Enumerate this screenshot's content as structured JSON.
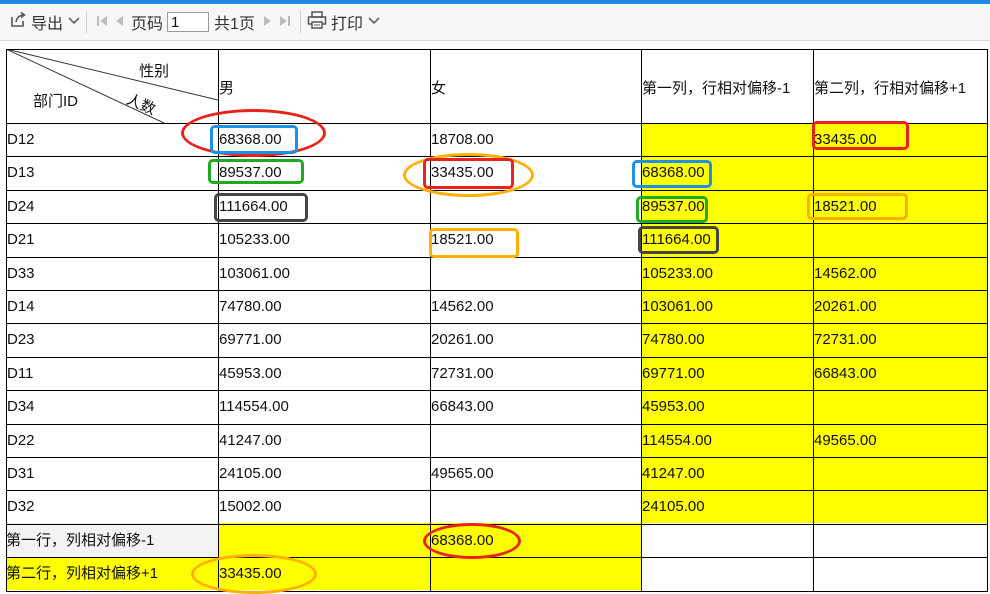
{
  "toolbar": {
    "export_label": "导出",
    "page_label": "页码",
    "page_value": "1",
    "total_label": "共1页",
    "print_label": "打印"
  },
  "table": {
    "corner": {
      "dept": "部门ID",
      "gender": "性别",
      "count": "人数"
    },
    "headers": [
      "男",
      "女",
      "第一列，行相对偏移-1",
      "第二列，行相对偏移+1"
    ],
    "rows": [
      {
        "id": "D12",
        "male": "68368.00",
        "female": "18708.00",
        "col1": "",
        "col2": "33435.00"
      },
      {
        "id": "D13",
        "male": "89537.00",
        "female": "33435.00",
        "col1": "68368.00",
        "col2": ""
      },
      {
        "id": "D24",
        "male": "111664.00",
        "female": "",
        "col1": "89537.00",
        "col2": "18521.00"
      },
      {
        "id": "D21",
        "male": "105233.00",
        "female": "18521.00",
        "col1": "111664.00",
        "col2": ""
      },
      {
        "id": "D33",
        "male": "103061.00",
        "female": "",
        "col1": "105233.00",
        "col2": "14562.00"
      },
      {
        "id": "D14",
        "male": "74780.00",
        "female": "14562.00",
        "col1": "103061.00",
        "col2": "20261.00"
      },
      {
        "id": "D23",
        "male": "69771.00",
        "female": "20261.00",
        "col1": "74780.00",
        "col2": "72731.00"
      },
      {
        "id": "D11",
        "male": "45953.00",
        "female": "72731.00",
        "col1": "69771.00",
        "col2": "66843.00"
      },
      {
        "id": "D34",
        "male": "114554.00",
        "female": "66843.00",
        "col1": "45953.00",
        "col2": ""
      },
      {
        "id": "D22",
        "male": "41247.00",
        "female": "",
        "col1": "114554.00",
        "col2": "49565.00"
      },
      {
        "id": "D31",
        "male": "24105.00",
        "female": "49565.00",
        "col1": "41247.00",
        "col2": ""
      },
      {
        "id": "D32",
        "male": "15002.00",
        "female": "",
        "col1": "24105.00",
        "col2": ""
      }
    ],
    "footer_rows": [
      {
        "label": "第一行，列相对偏移-1",
        "male": "",
        "female": "68368.00",
        "col1": "",
        "col2": ""
      },
      {
        "label": "第二行，列相对偏移+1",
        "male": "33435.00",
        "female": "",
        "col1": "",
        "col2": ""
      }
    ]
  },
  "colors": {
    "highlight_yellow": "#ffff00",
    "red": "#e8231c",
    "blue": "#1e90e6",
    "green": "#1faa1f",
    "dark": "#454545",
    "orange": "#ffb000"
  }
}
